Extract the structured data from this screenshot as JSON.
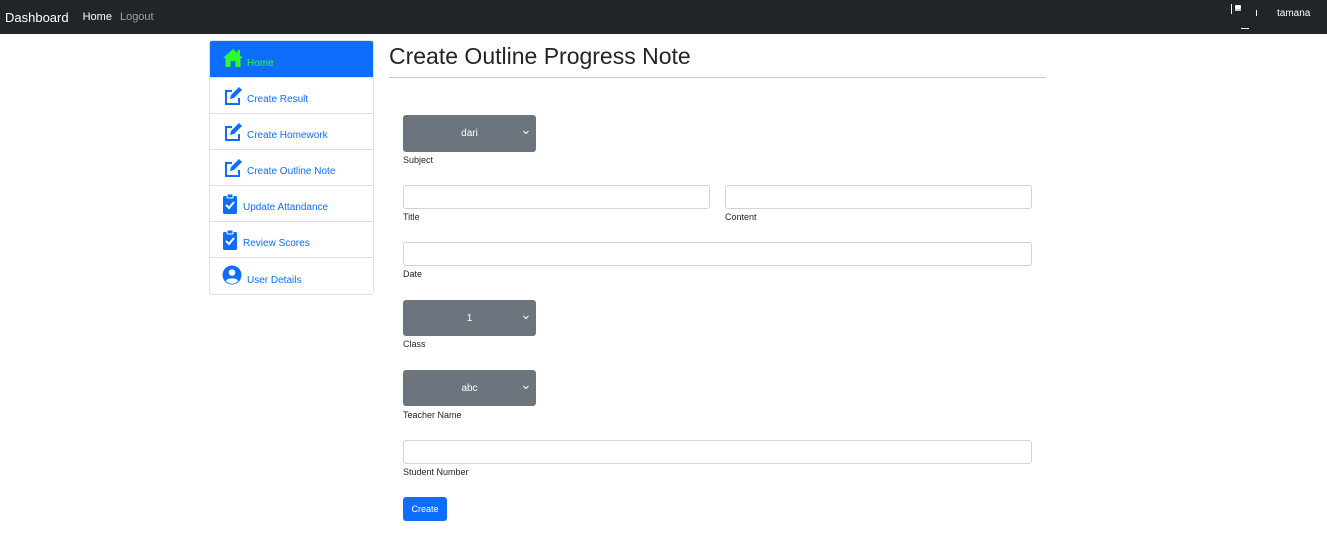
{
  "navbar": {
    "brand": "Dashboard",
    "links": [
      {
        "label": "Home"
      },
      {
        "label": "Logout"
      }
    ],
    "username": "tamana"
  },
  "sidebar": {
    "items": [
      {
        "label": "Home",
        "icon": "home-icon",
        "active": true
      },
      {
        "label": "Create Result",
        "icon": "edit-icon"
      },
      {
        "label": "Create Homework",
        "icon": "edit-icon"
      },
      {
        "label": "Create Outline Note",
        "icon": "edit-icon"
      },
      {
        "label": "Update Attandance",
        "icon": "clipboard-check-icon"
      },
      {
        "label": "Review Scores",
        "icon": "clipboard-check-icon"
      },
      {
        "label": "User Details",
        "icon": "user-circle-icon"
      }
    ]
  },
  "main": {
    "title": "Create Outline Progress Note",
    "subject": {
      "value": "dari",
      "label": "Subject"
    },
    "title_field": {
      "label": "Title",
      "value": ""
    },
    "content_field": {
      "label": "Content",
      "value": ""
    },
    "date_field": {
      "label": "Date",
      "value": ""
    },
    "class": {
      "value": "1",
      "label": "Class"
    },
    "teacher": {
      "value": "abc",
      "label": "Teacher Name"
    },
    "student_number": {
      "label": "Student Number",
      "value": ""
    },
    "create_button": "Create"
  },
  "colors": {
    "navbar_bg": "#212529",
    "primary": "#0d6efd",
    "select_bg": "#6c757d",
    "active_text": "#2bff2b"
  }
}
